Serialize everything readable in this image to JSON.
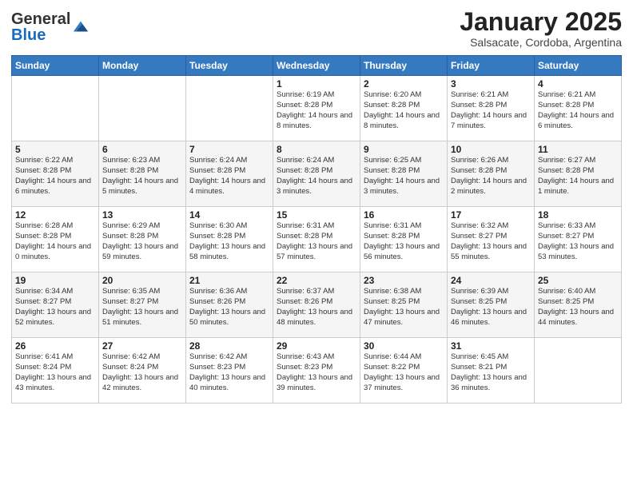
{
  "logo": {
    "general": "General",
    "blue": "Blue"
  },
  "header": {
    "month": "January 2025",
    "location": "Salsacate, Cordoba, Argentina"
  },
  "weekdays": [
    "Sunday",
    "Monday",
    "Tuesday",
    "Wednesday",
    "Thursday",
    "Friday",
    "Saturday"
  ],
  "weeks": [
    [
      {
        "day": "",
        "info": ""
      },
      {
        "day": "",
        "info": ""
      },
      {
        "day": "",
        "info": ""
      },
      {
        "day": "1",
        "info": "Sunrise: 6:19 AM\nSunset: 8:28 PM\nDaylight: 14 hours and 8 minutes."
      },
      {
        "day": "2",
        "info": "Sunrise: 6:20 AM\nSunset: 8:28 PM\nDaylight: 14 hours and 8 minutes."
      },
      {
        "day": "3",
        "info": "Sunrise: 6:21 AM\nSunset: 8:28 PM\nDaylight: 14 hours and 7 minutes."
      },
      {
        "day": "4",
        "info": "Sunrise: 6:21 AM\nSunset: 8:28 PM\nDaylight: 14 hours and 6 minutes."
      }
    ],
    [
      {
        "day": "5",
        "info": "Sunrise: 6:22 AM\nSunset: 8:28 PM\nDaylight: 14 hours and 6 minutes."
      },
      {
        "day": "6",
        "info": "Sunrise: 6:23 AM\nSunset: 8:28 PM\nDaylight: 14 hours and 5 minutes."
      },
      {
        "day": "7",
        "info": "Sunrise: 6:24 AM\nSunset: 8:28 PM\nDaylight: 14 hours and 4 minutes."
      },
      {
        "day": "8",
        "info": "Sunrise: 6:24 AM\nSunset: 8:28 PM\nDaylight: 14 hours and 3 minutes."
      },
      {
        "day": "9",
        "info": "Sunrise: 6:25 AM\nSunset: 8:28 PM\nDaylight: 14 hours and 3 minutes."
      },
      {
        "day": "10",
        "info": "Sunrise: 6:26 AM\nSunset: 8:28 PM\nDaylight: 14 hours and 2 minutes."
      },
      {
        "day": "11",
        "info": "Sunrise: 6:27 AM\nSunset: 8:28 PM\nDaylight: 14 hours and 1 minute."
      }
    ],
    [
      {
        "day": "12",
        "info": "Sunrise: 6:28 AM\nSunset: 8:28 PM\nDaylight: 14 hours and 0 minutes."
      },
      {
        "day": "13",
        "info": "Sunrise: 6:29 AM\nSunset: 8:28 PM\nDaylight: 13 hours and 59 minutes."
      },
      {
        "day": "14",
        "info": "Sunrise: 6:30 AM\nSunset: 8:28 PM\nDaylight: 13 hours and 58 minutes."
      },
      {
        "day": "15",
        "info": "Sunrise: 6:31 AM\nSunset: 8:28 PM\nDaylight: 13 hours and 57 minutes."
      },
      {
        "day": "16",
        "info": "Sunrise: 6:31 AM\nSunset: 8:28 PM\nDaylight: 13 hours and 56 minutes."
      },
      {
        "day": "17",
        "info": "Sunrise: 6:32 AM\nSunset: 8:27 PM\nDaylight: 13 hours and 55 minutes."
      },
      {
        "day": "18",
        "info": "Sunrise: 6:33 AM\nSunset: 8:27 PM\nDaylight: 13 hours and 53 minutes."
      }
    ],
    [
      {
        "day": "19",
        "info": "Sunrise: 6:34 AM\nSunset: 8:27 PM\nDaylight: 13 hours and 52 minutes."
      },
      {
        "day": "20",
        "info": "Sunrise: 6:35 AM\nSunset: 8:27 PM\nDaylight: 13 hours and 51 minutes."
      },
      {
        "day": "21",
        "info": "Sunrise: 6:36 AM\nSunset: 8:26 PM\nDaylight: 13 hours and 50 minutes."
      },
      {
        "day": "22",
        "info": "Sunrise: 6:37 AM\nSunset: 8:26 PM\nDaylight: 13 hours and 48 minutes."
      },
      {
        "day": "23",
        "info": "Sunrise: 6:38 AM\nSunset: 8:25 PM\nDaylight: 13 hours and 47 minutes."
      },
      {
        "day": "24",
        "info": "Sunrise: 6:39 AM\nSunset: 8:25 PM\nDaylight: 13 hours and 46 minutes."
      },
      {
        "day": "25",
        "info": "Sunrise: 6:40 AM\nSunset: 8:25 PM\nDaylight: 13 hours and 44 minutes."
      }
    ],
    [
      {
        "day": "26",
        "info": "Sunrise: 6:41 AM\nSunset: 8:24 PM\nDaylight: 13 hours and 43 minutes."
      },
      {
        "day": "27",
        "info": "Sunrise: 6:42 AM\nSunset: 8:24 PM\nDaylight: 13 hours and 42 minutes."
      },
      {
        "day": "28",
        "info": "Sunrise: 6:42 AM\nSunset: 8:23 PM\nDaylight: 13 hours and 40 minutes."
      },
      {
        "day": "29",
        "info": "Sunrise: 6:43 AM\nSunset: 8:23 PM\nDaylight: 13 hours and 39 minutes."
      },
      {
        "day": "30",
        "info": "Sunrise: 6:44 AM\nSunset: 8:22 PM\nDaylight: 13 hours and 37 minutes."
      },
      {
        "day": "31",
        "info": "Sunrise: 6:45 AM\nSunset: 8:21 PM\nDaylight: 13 hours and 36 minutes."
      },
      {
        "day": "",
        "info": ""
      }
    ]
  ]
}
